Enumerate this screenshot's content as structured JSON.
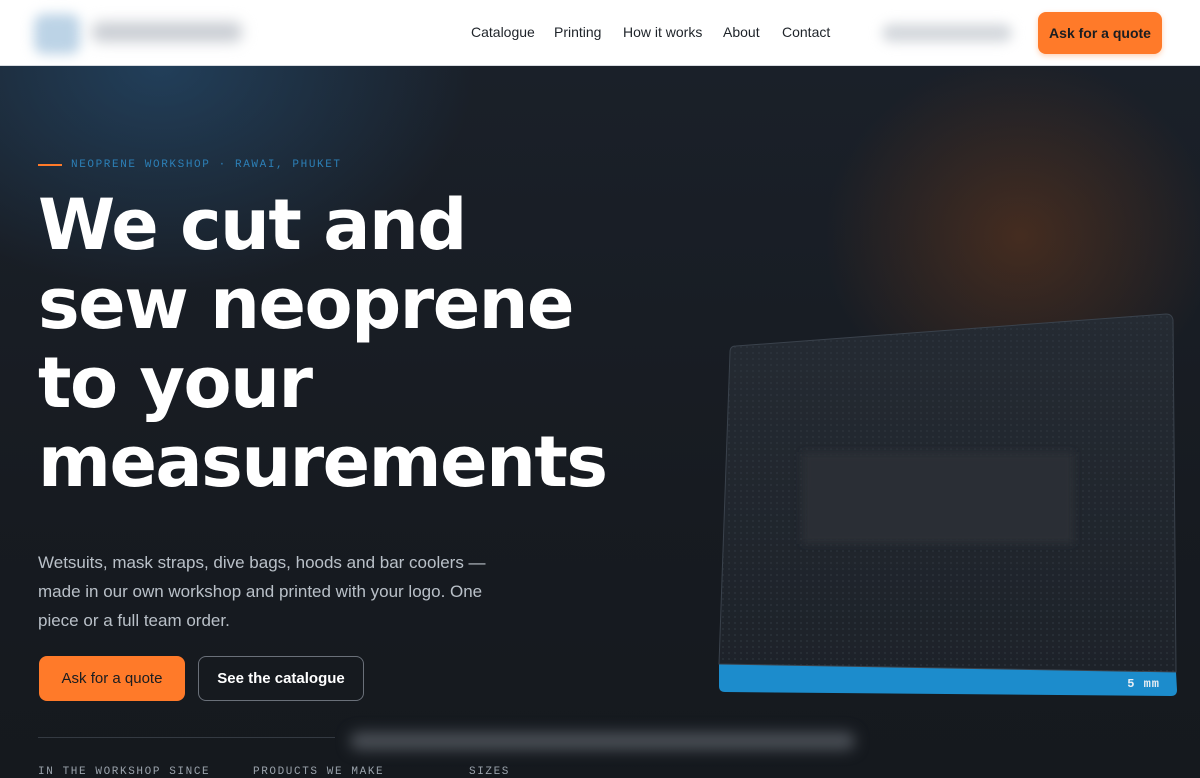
{
  "header": {
    "nav": [
      {
        "label": "Catalogue"
      },
      {
        "label": "Printing"
      },
      {
        "label": "How it works"
      },
      {
        "label": "About"
      },
      {
        "label": "Contact"
      }
    ],
    "quote_button": "Ask for a quote"
  },
  "hero": {
    "eyebrow": "NEOPRENE WORKSHOP · RAWAI, PHUKET",
    "headline": [
      "We cut and",
      "sew neoprene",
      "to your",
      "measurements"
    ],
    "lead": "Wetsuits, mask straps, dive bags, hoods and bar coolers — made in our own workshop and printed with your logo. One piece or a full team order.",
    "primary_button": "Ask for a quote",
    "secondary_button": "See the catalogue",
    "stats": [
      {
        "label": "IN THE WORKSHOP SINCE"
      },
      {
        "label": "PRODUCTS WE MAKE"
      },
      {
        "label": "SIZES"
      }
    ],
    "sample": {
      "thickness_label": "5 mm"
    }
  },
  "colors": {
    "accent": "#ff7a29",
    "eyebrow": "#2c7fb6",
    "edge_blue": "#1c8ccc"
  }
}
